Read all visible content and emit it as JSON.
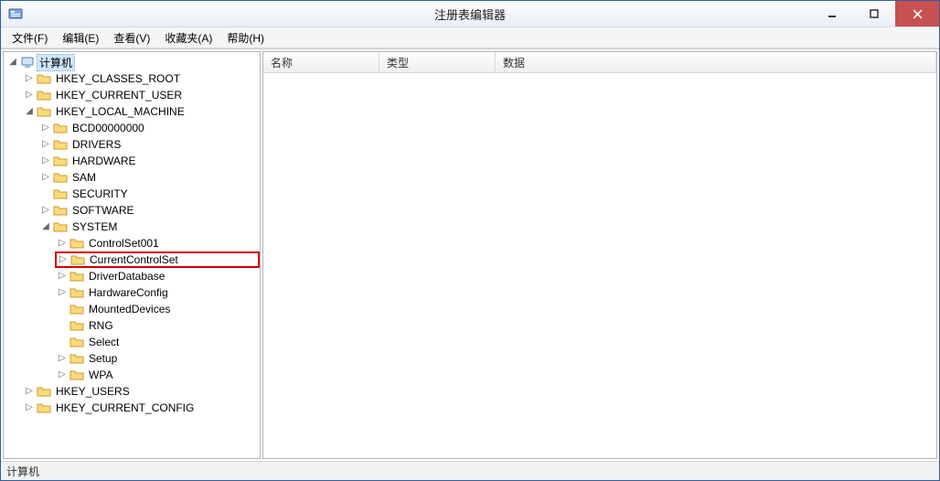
{
  "window": {
    "title": "注册表编辑器"
  },
  "menu": {
    "file": "文件(F)",
    "edit": "编辑(E)",
    "view": "查看(V)",
    "fav": "收藏夹(A)",
    "help": "帮助(H)"
  },
  "columns": {
    "name": "名称",
    "type": "类型",
    "data": "数据"
  },
  "tree": {
    "root": "计算机",
    "hkcr": "HKEY_CLASSES_ROOT",
    "hkcu": "HKEY_CURRENT_USER",
    "hklm": "HKEY_LOCAL_MACHINE",
    "hklm_children": {
      "bcd": "BCD00000000",
      "drivers": "DRIVERS",
      "hardware": "HARDWARE",
      "sam": "SAM",
      "security": "SECURITY",
      "software": "SOFTWARE",
      "system": "SYSTEM"
    },
    "system_children": {
      "cs001": "ControlSet001",
      "ccs": "CurrentControlSet",
      "ddb": "DriverDatabase",
      "hwcfg": "HardwareConfig",
      "mdev": "MountedDevices",
      "rng": "RNG",
      "select": "Select",
      "setup": "Setup",
      "wpa": "WPA"
    },
    "hku": "HKEY_USERS",
    "hkcc": "HKEY_CURRENT_CONFIG"
  },
  "status": "计算机",
  "glyphs": {
    "expanded": "◢",
    "collapsed": "▷"
  }
}
